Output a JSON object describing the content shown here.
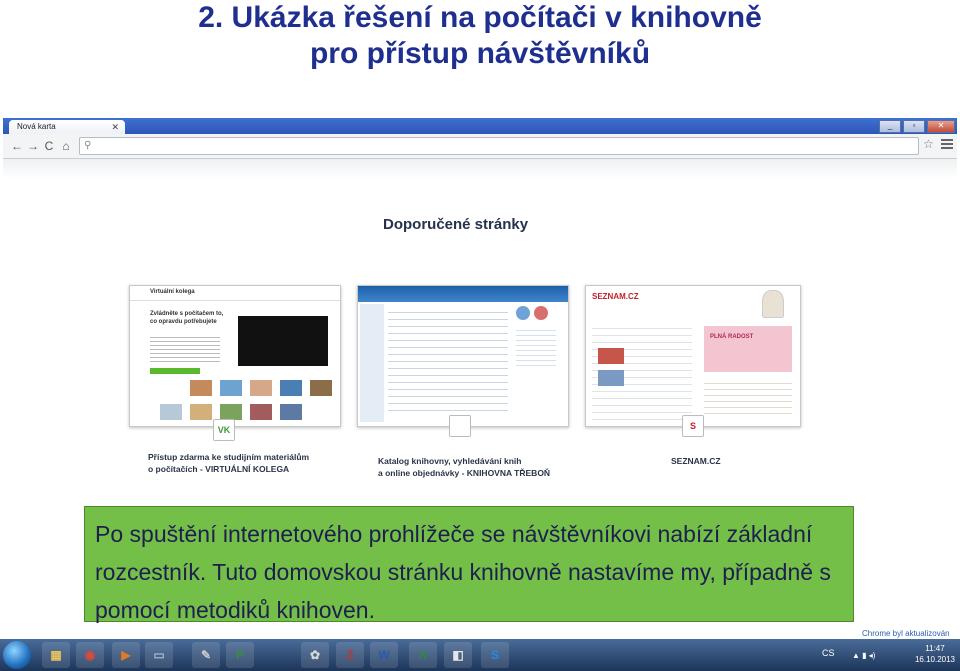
{
  "slide": {
    "title_line1": "2. Ukázka řešení na počítači v knihovně",
    "title_line2": "pro přístup návštěvníků"
  },
  "browser": {
    "tab_label": "Nová karta",
    "tab_close": "✕",
    "window_buttons": {
      "minimize": "_",
      "restore": "▫",
      "close": "✕"
    },
    "nav": {
      "back": "←",
      "forward": "→",
      "reload": "C",
      "home": "⌂"
    },
    "search_glyph": "⚲",
    "star_glyph": "☆"
  },
  "newtab": {
    "section_title": "Doporučené stránky",
    "thumbnails": [
      {
        "caption_line1": "Přístup zdarma ke studijním materiálům",
        "caption_line2": "o počítačích - VIRTUÁLNÍ KOLEGA",
        "preview_title": "Virtuální kolega",
        "preview_text": "Zvládněte s počítačem to, co opravdu potřebujete",
        "badge": "VK"
      },
      {
        "caption_line1": "Katalog knihovny, vyhledávání knih",
        "caption_line2": "a online objednávky - KNIHOVNA TŘEBOŇ",
        "badge": ""
      },
      {
        "caption_line1": "SEZNAM.CZ",
        "caption_line2": "",
        "preview_title": "SEZNAM.CZ",
        "preview_text": "PLNÁ RADOST",
        "badge": "S"
      }
    ]
  },
  "callout": {
    "text": "Po spuštění internetového prohlížeče se návštěvníkovi nabízí základní rozcestník. Tuto domovskou stránku knihovně nastavíme my, případně s pomocí metodiků knihoven."
  },
  "notification": {
    "text": "Chrome byl aktualizován"
  },
  "taskbar": {
    "language": "CS",
    "tray": "▲ ▮ ◂)",
    "time": "11:47",
    "date": "16.10.2013",
    "apps": [
      {
        "name": "explorer",
        "glyph": "▦",
        "color": "#e8c25a"
      },
      {
        "name": "chrome",
        "glyph": "◉",
        "color": "#d94a3a"
      },
      {
        "name": "media-player",
        "glyph": "▶",
        "color": "#e07b1f"
      },
      {
        "name": "tablet",
        "glyph": "▭",
        "color": "#9cb8d8"
      },
      {
        "name": "tools",
        "glyph": "✎",
        "color": "#c9c9c9"
      },
      {
        "name": "powerpoint-viewer",
        "glyph": "P",
        "color": "#3c8a3c"
      },
      {
        "name": "paint",
        "glyph": "✿",
        "color": "#d8d8d8"
      },
      {
        "name": "filezilla",
        "glyph": "Z",
        "color": "#c0362c"
      },
      {
        "name": "word",
        "glyph": "W",
        "color": "#2b5aa8"
      },
      {
        "name": "excel",
        "glyph": "X",
        "color": "#2f8a3a"
      },
      {
        "name": "pdf-tool",
        "glyph": "◧",
        "color": "#e6e6e6"
      },
      {
        "name": "skype",
        "glyph": "S",
        "color": "#1d8fe0"
      }
    ]
  }
}
